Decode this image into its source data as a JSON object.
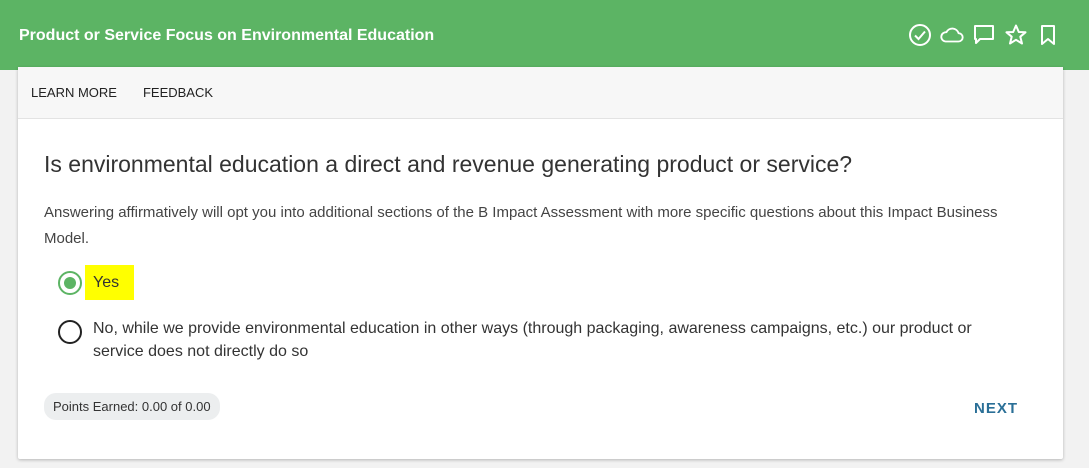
{
  "header": {
    "title": "Product or Service Focus on Environmental Education",
    "icons": [
      "check-circle-icon",
      "cloud-icon",
      "comment-icon",
      "star-icon",
      "bookmark-icon"
    ],
    "background": "#5cb464"
  },
  "tabs": [
    {
      "label": "LEARN MORE"
    },
    {
      "label": "FEEDBACK"
    }
  ],
  "question": {
    "title": "Is environmental education a direct and revenue generating product or service?",
    "description": "Answering affirmatively will opt you into additional sections of the B Impact Assessment with more specific questions about this Impact Business Model."
  },
  "options": [
    {
      "label": "Yes",
      "selected": true
    },
    {
      "label": "No, while we provide environmental education in other ways (through packaging, awareness campaigns, etc.) our product or service does not directly do so",
      "selected": false
    }
  ],
  "footer": {
    "points": "Points Earned: 0.00 of 0.00",
    "next_label": "NEXT"
  },
  "colors": {
    "accent": "#5cb464",
    "link": "#2a6f97",
    "highlight": "#ffff00"
  }
}
